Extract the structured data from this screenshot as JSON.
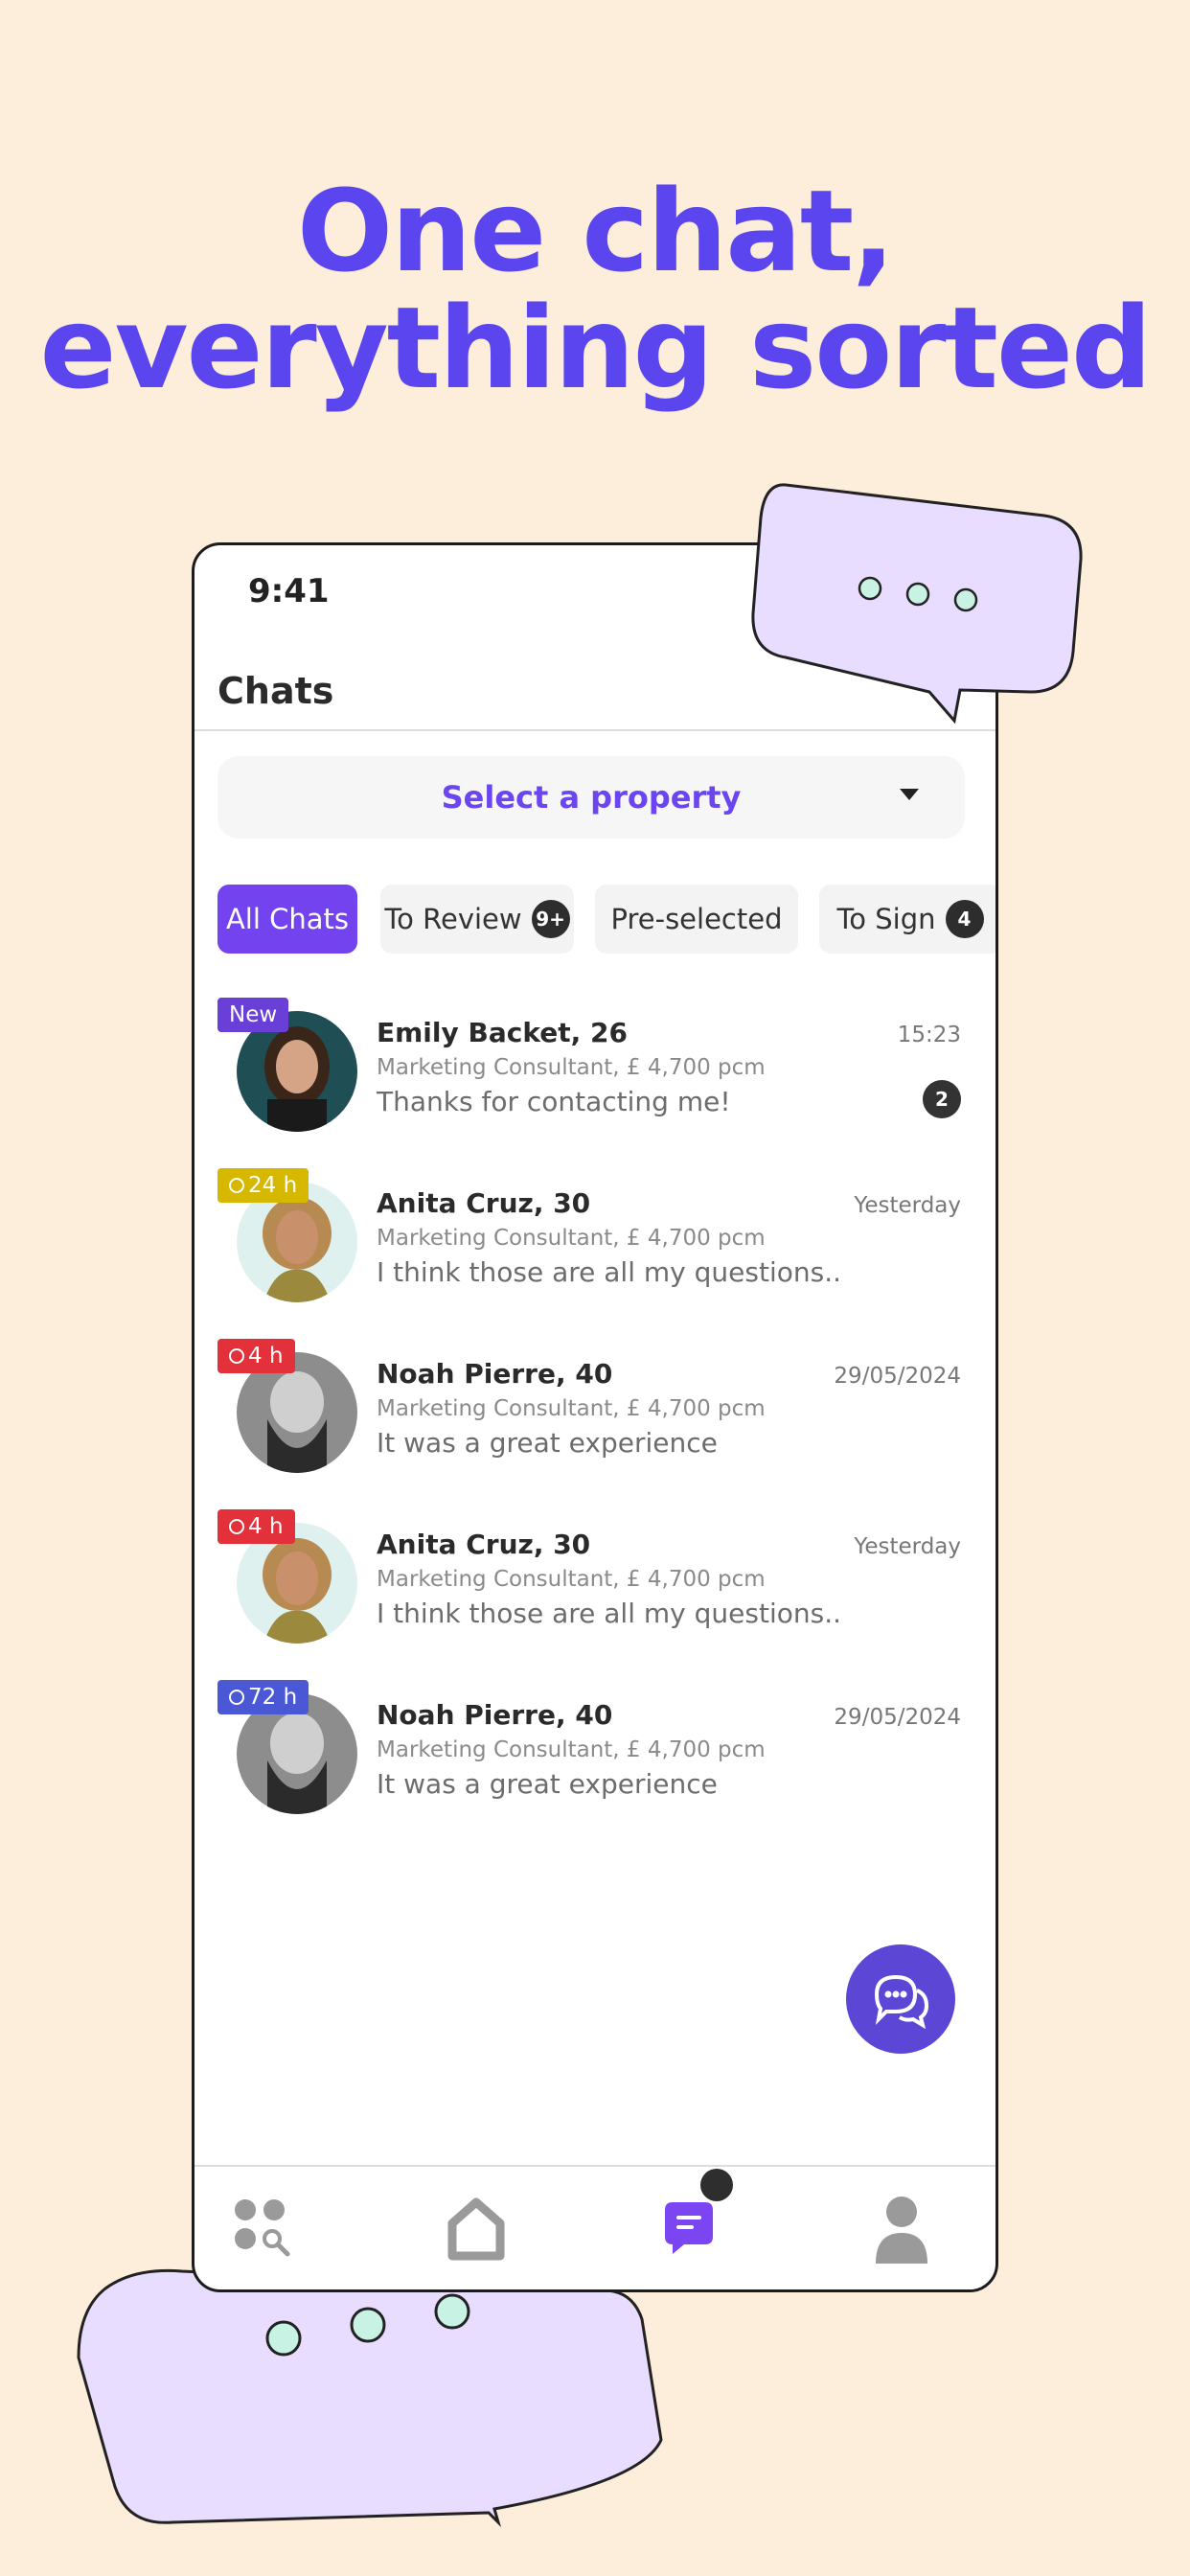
{
  "headline": {
    "line1": "One chat,",
    "line2": "everything sorted"
  },
  "status_bar": {
    "time": "9:41"
  },
  "header": {
    "title": "Chats"
  },
  "property_select": {
    "label": "Select a property"
  },
  "tabs": [
    {
      "label": "All Chats",
      "count": ""
    },
    {
      "label": "To Review",
      "count": "9+"
    },
    {
      "label": "Pre-selected",
      "count": ""
    },
    {
      "label": "To Sign",
      "count": "4"
    }
  ],
  "chats": [
    {
      "badge": "New",
      "badge_color": "#6a3fd8",
      "name": "Emily Backet, 26",
      "subtitle": "Marketing Consultant, £ 4,700 pcm",
      "message": "Thanks for contacting me!",
      "time": "15:23",
      "unread": "2"
    },
    {
      "badge": "24 h",
      "badge_color": "#d6b800",
      "name": "Anita Cruz, 30",
      "subtitle": "Marketing Consultant, £ 4,700 pcm",
      "message": "I think those are all my questions..",
      "time": "Yesterday",
      "unread": ""
    },
    {
      "badge": "4 h",
      "badge_color": "#e3313b",
      "name": "Noah Pierre, 40",
      "subtitle": "Marketing Consultant, £ 4,700 pcm",
      "message": "It was a great experience",
      "time": "29/05/2024",
      "unread": ""
    },
    {
      "badge": "4 h",
      "badge_color": "#e3313b",
      "name": "Anita Cruz, 30",
      "subtitle": "Marketing Consultant, £ 4,700 pcm",
      "message": "I think those are all my questions..",
      "time": "Yesterday",
      "unread": ""
    },
    {
      "badge": "72 h",
      "badge_color": "#4a58d6",
      "name": "Noah Pierre, 40",
      "subtitle": "Marketing Consultant, £ 4,700 pcm",
      "message": "It was a great experience",
      "time": "29/05/2024",
      "unread": ""
    }
  ],
  "bottom_nav": [
    {
      "icon": "search-properties-icon"
    },
    {
      "icon": "home-icon"
    },
    {
      "icon": "chat-icon",
      "active": true
    },
    {
      "icon": "profile-icon"
    }
  ],
  "colors": {
    "accent": "#5b45ee",
    "tab_active": "#7443f0",
    "background": "#fdeedb",
    "bubble": "#e8dcff",
    "bubble_dot": "#c8f2e4"
  }
}
